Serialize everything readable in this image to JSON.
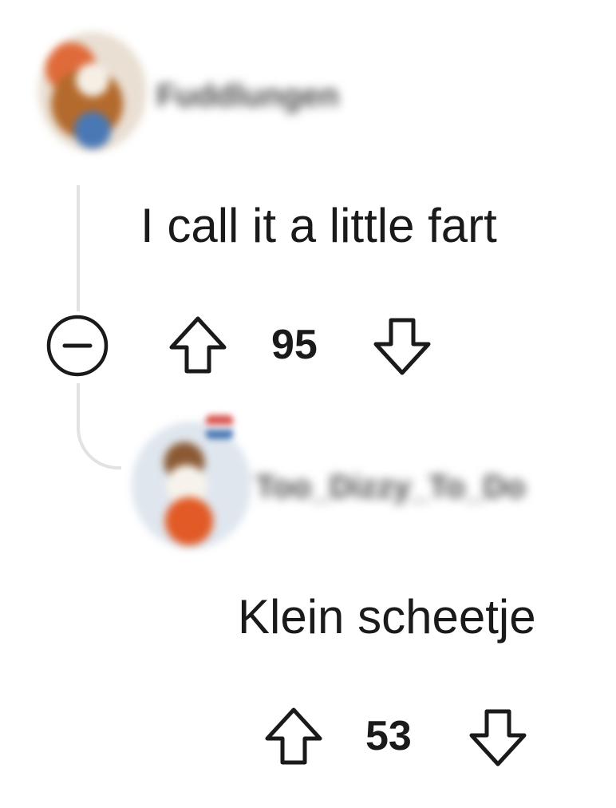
{
  "comments": [
    {
      "username": "Fuddlungen",
      "text": "I call it a little fart",
      "score": "95",
      "icons": [
        "avatar",
        "collapse-icon",
        "upvote-icon",
        "downvote-icon"
      ]
    },
    {
      "username": "Too_Dizzy_To_Do",
      "text": "Klein scheetje",
      "score": "53",
      "icons": [
        "avatar",
        "upvote-icon",
        "downvote-icon"
      ]
    }
  ],
  "colors": {
    "text": "#1a1a1b",
    "thread_line": "#e2e2e2",
    "background": "#ffffff"
  }
}
